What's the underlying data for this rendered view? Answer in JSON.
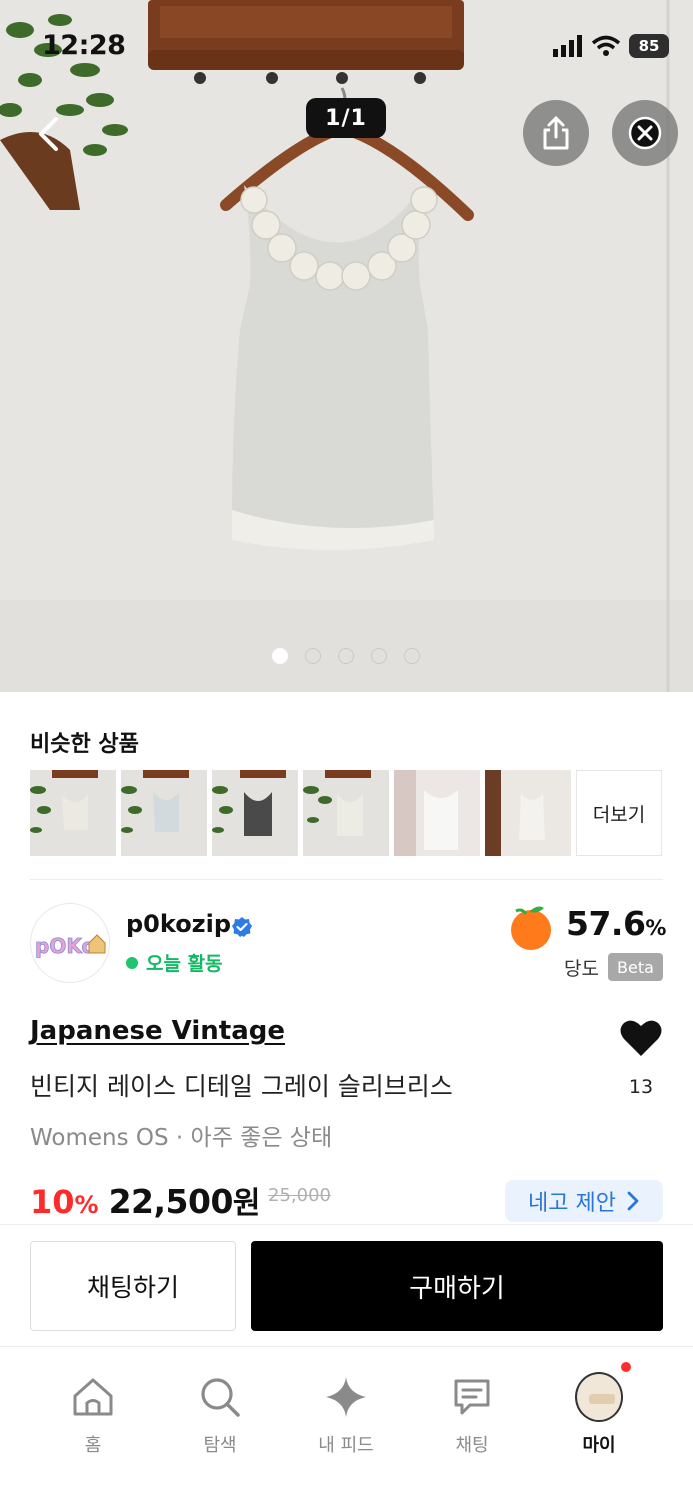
{
  "status_bar": {
    "time": "12:28",
    "battery": "85"
  },
  "hero": {
    "image_counter": "1/1",
    "page_count": 5,
    "active_page": 1
  },
  "similar": {
    "title": "비슷한 상품",
    "more_label": "더보기"
  },
  "seller": {
    "avatar_text": "pOKo",
    "name": "p0kozip",
    "activity": "오늘 활동",
    "dangdo_value": "57.6",
    "dangdo_unit": "%",
    "dangdo_label": "당도",
    "beta_label": "Beta"
  },
  "product": {
    "brand": "Japanese Vintage",
    "title": "빈티지 레이스 디테일 그레이 슬리브리스",
    "meta": "Womens OS · 아주 좋은 상태",
    "likes": "13",
    "discount": "10",
    "discount_unit": "%",
    "price": "22,500",
    "price_unit": "원",
    "original_price": "25,000",
    "offer_label": "네고 제안"
  },
  "actions": {
    "chat_label": "채팅하기",
    "buy_label": "구매하기"
  },
  "tabbar": {
    "items": [
      {
        "label": "홈",
        "icon": "home-icon"
      },
      {
        "label": "탐색",
        "icon": "search-icon"
      },
      {
        "label": "내 피드",
        "icon": "sparkle-icon"
      },
      {
        "label": "채팅",
        "icon": "chat-icon"
      },
      {
        "label": "마이",
        "icon": "profile-avatar"
      }
    ],
    "active_index": 4
  },
  "colors": {
    "discount": "#ff2b2b",
    "online": "#20c46f",
    "offer_bg": "#eaf3fd",
    "offer_text": "#2a76d6",
    "notification": "#ff2d2d"
  }
}
